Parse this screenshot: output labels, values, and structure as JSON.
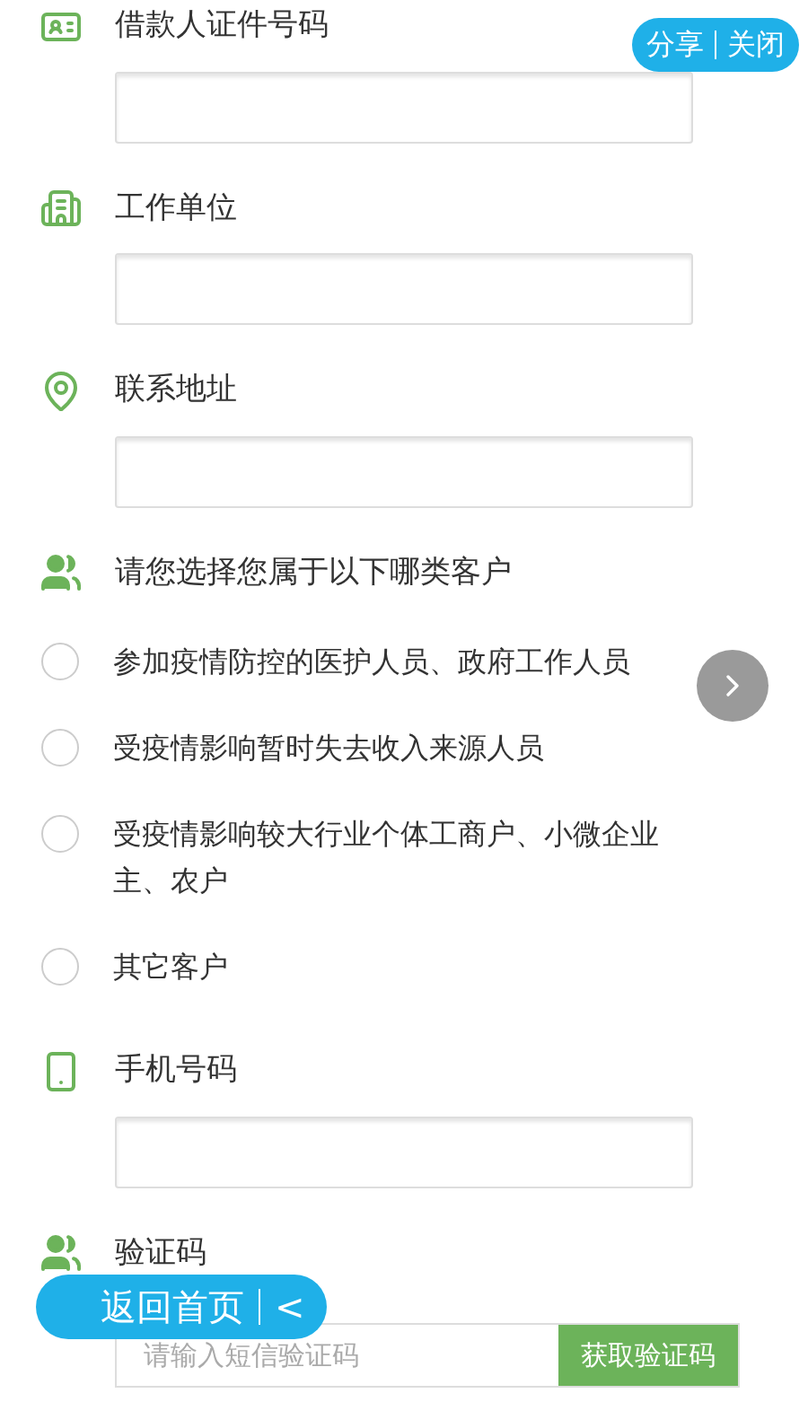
{
  "fields": [
    {
      "kind": "id",
      "label": "借款人证件号码"
    },
    {
      "kind": "company",
      "label": "工作单位"
    },
    {
      "kind": "address",
      "label": "联系地址"
    }
  ],
  "question": {
    "label": "请您选择您属于以下哪类客户",
    "options": [
      {
        "label": "参加疫情防控的医护人员、政府工作人员",
        "selected": false
      },
      {
        "label": "受疫情影响暂时失去收入来源人员",
        "selected": false
      },
      {
        "label": "受疫情影响较大行业个体工商户、小微企业主、农户",
        "selected": false
      },
      {
        "label": "其它客户",
        "selected": false
      }
    ]
  },
  "phone": {
    "label": "手机号码"
  },
  "verify": {
    "label": "验证码",
    "placeholder": "请输入短信验证码",
    "button": "获取验证码"
  },
  "share_bar": {
    "share": "分享",
    "close": "关闭"
  },
  "home_button": {
    "label": "返回首页",
    "arrow": "<"
  }
}
